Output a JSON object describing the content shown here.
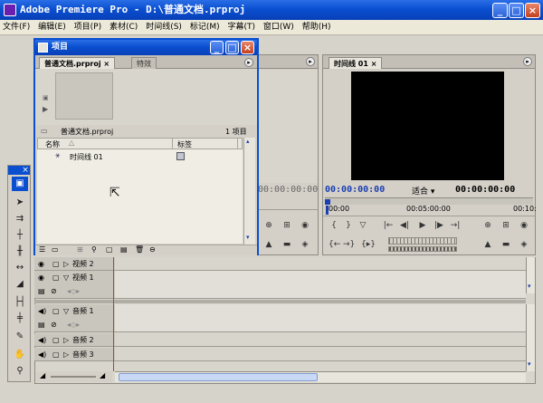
{
  "window": {
    "title": "Adobe Premiere Pro - D:\\普通文档.prproj",
    "min": "_",
    "max": "□",
    "close": "×"
  },
  "menu": [
    "文件(F)",
    "编辑(E)",
    "项目(P)",
    "素材(C)",
    "时间线(S)",
    "标记(M)",
    "字幕(T)",
    "窗口(W)",
    "帮助(H)"
  ],
  "project": {
    "title": "项目",
    "tabs": [
      "普通文档.prproj",
      "特效"
    ],
    "tab_close": "×",
    "file_name": "普通文档.prproj",
    "item_count": "1 项目",
    "col_name": "名称",
    "col_label": "标签",
    "items": [
      {
        "name": "时间线 01"
      }
    ]
  },
  "monitor": {
    "tab": "时间线 01",
    "tab_close": "×",
    "timecode": "00:00:00:00",
    "timecode_end": "00:00:00:00",
    "fit": "适合",
    "ruler_start": "00:00",
    "ruler_mid": "00:05:00:00",
    "ruler_end": "00:10:",
    "left_timecode": "00:00:00:00"
  },
  "timeline": {
    "tracks": [
      {
        "label": "视频 2"
      },
      {
        "label": "视频 1"
      },
      {
        "label": "音频 1"
      },
      {
        "label": "音频 2"
      },
      {
        "label": "音频 3"
      }
    ]
  },
  "tools_close": "×",
  "colors": {
    "xp_blue": "#0a4fd0",
    "playhead": "#c04020"
  }
}
